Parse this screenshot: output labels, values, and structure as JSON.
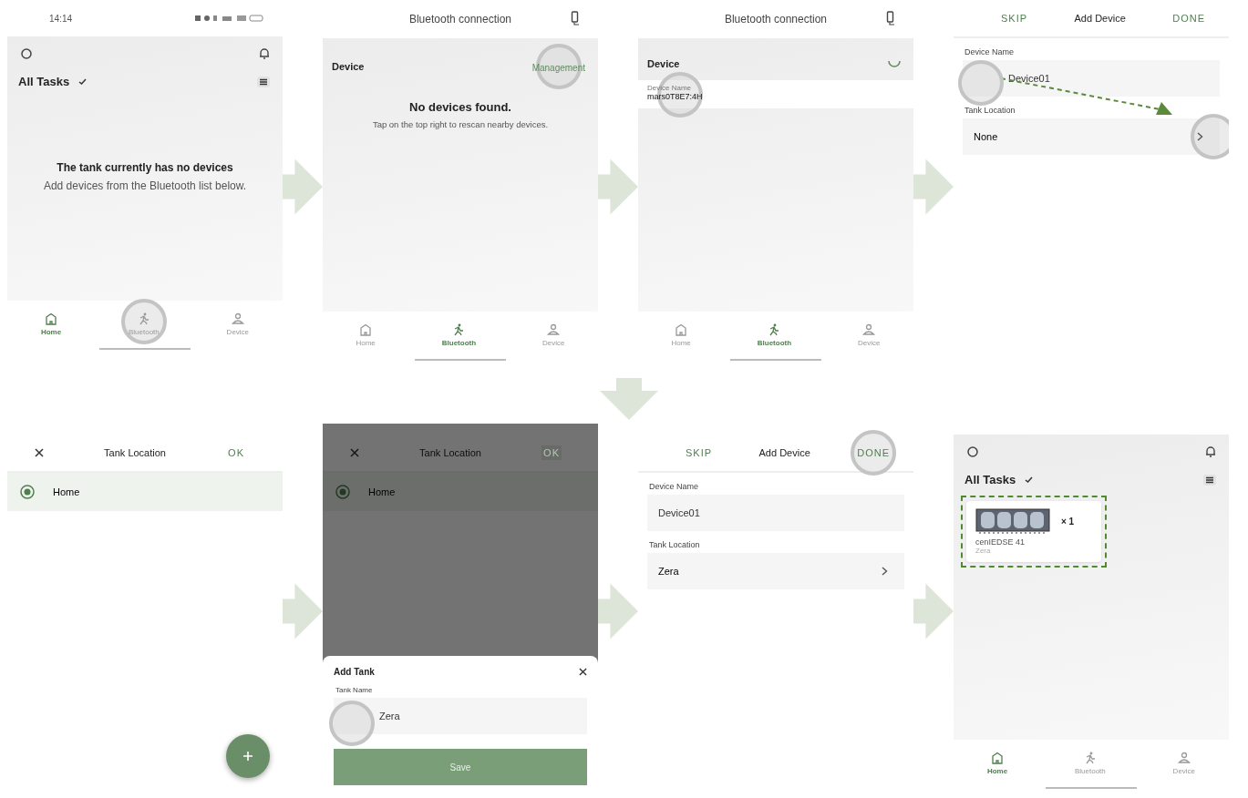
{
  "screens": [
    {
      "kind": "home",
      "status_bar": {
        "time": "14:14"
      },
      "title": "All Tasks",
      "empty": {
        "heading": "The tank currently has no devices",
        "text": "Add devices from the Bluetooth list below."
      },
      "nav": [
        {
          "label": "Home",
          "selected": true,
          "tapped": false
        },
        {
          "label": "Bluetooth",
          "selected": false,
          "tapped": true
        },
        {
          "label": "Device",
          "selected": false,
          "tapped": false
        }
      ]
    },
    {
      "kind": "bluetooth",
      "title": "Bluetooth connection",
      "section": "Device",
      "action": {
        "label": "Management",
        "tapped": true
      },
      "empty": {
        "heading": "No devices found.",
        "text": "Tap on the top right to rescan nearby devices."
      },
      "nav": [
        {
          "label": "Home",
          "selected": false,
          "tapped": false
        },
        {
          "label": "Bluetooth",
          "selected": true,
          "tapped": false
        },
        {
          "label": "Device",
          "selected": false,
          "tapped": false
        }
      ]
    },
    {
      "kind": "bluetooth",
      "title": "Bluetooth connection",
      "section": "Device",
      "scanning": true,
      "devices": [
        {
          "label": "Device Name",
          "name": "mars0T8E7:4H",
          "tapped": true
        }
      ],
      "nav": [
        {
          "label": "Home",
          "selected": false,
          "tapped": false
        },
        {
          "label": "Bluetooth",
          "selected": true,
          "tapped": false
        },
        {
          "label": "Device",
          "selected": false,
          "tapped": false
        }
      ]
    },
    {
      "kind": "add_device",
      "header": {
        "left": "SKIP",
        "title": "Add Device",
        "right": "DONE"
      },
      "name_label": "Device Name",
      "name_field": {
        "value": "Device01",
        "tapped": true
      },
      "location_label": "Tank Location",
      "location": {
        "value": "None",
        "tapped": true
      }
    },
    {
      "kind": "tank_location",
      "header": {
        "title": "Tank Location",
        "right": "OK"
      },
      "options": [
        {
          "label": "Home",
          "selected": true
        }
      ],
      "fab": true
    },
    {
      "kind": "tank_location",
      "header": {
        "title": "Tank Location",
        "right": "OK"
      },
      "options": [
        {
          "label": "Home",
          "selected": true
        }
      ],
      "sheet": {
        "title": "Add Tank",
        "field_label": "Tank Name",
        "field": {
          "value": "Zera",
          "tapped": true
        },
        "button": "Save"
      }
    },
    {
      "kind": "add_device",
      "header": {
        "left": "SKIP",
        "title": "Add Device",
        "right": "DONE",
        "right_tapped": true
      },
      "name_label": "Device Name",
      "name_field": {
        "value": "Device01"
      },
      "location_label": "Tank Location",
      "location": {
        "value": "Zera"
      }
    },
    {
      "kind": "home",
      "title": "All Tasks",
      "devices": [
        {
          "count": "× 1",
          "name": "cenIEDSE 41",
          "location": "Zera",
          "highlighted": true
        }
      ],
      "nav": [
        {
          "label": "Home",
          "selected": true,
          "tapped": false
        },
        {
          "label": "Bluetooth",
          "selected": false,
          "tapped": false
        },
        {
          "label": "Device",
          "selected": false,
          "tapped": false
        }
      ]
    }
  ]
}
